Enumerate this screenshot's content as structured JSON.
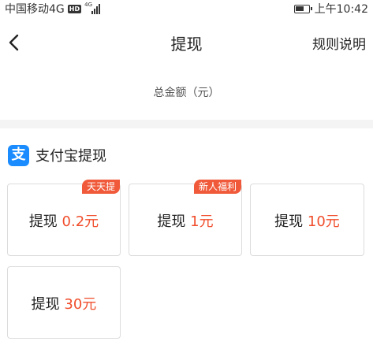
{
  "status_bar": {
    "carrier": "中国移动4G",
    "hd": "HD",
    "network": "4G",
    "time": "上午10:42"
  },
  "nav": {
    "title": "提现",
    "rules_label": "规则说明"
  },
  "total": {
    "label": "总金额（元）"
  },
  "alipay": {
    "icon_char": "支",
    "title": "支付宝提现",
    "options": [
      {
        "prefix": "提现",
        "amount": "0.2元",
        "badge": "天天提"
      },
      {
        "prefix": "提现",
        "amount": "1元",
        "badge": "新人福利"
      },
      {
        "prefix": "提现",
        "amount": "10元",
        "badge": ""
      },
      {
        "prefix": "提现",
        "amount": "30元",
        "badge": ""
      }
    ]
  },
  "colors": {
    "accent": "#f04e2c",
    "badge": "#f05a3a",
    "alipay_blue": "#1a8cff",
    "band": "#f4f4f4"
  },
  "icons": [
    "signal-icon",
    "battery-icon",
    "back-arrow-icon",
    "alipay-icon"
  ]
}
